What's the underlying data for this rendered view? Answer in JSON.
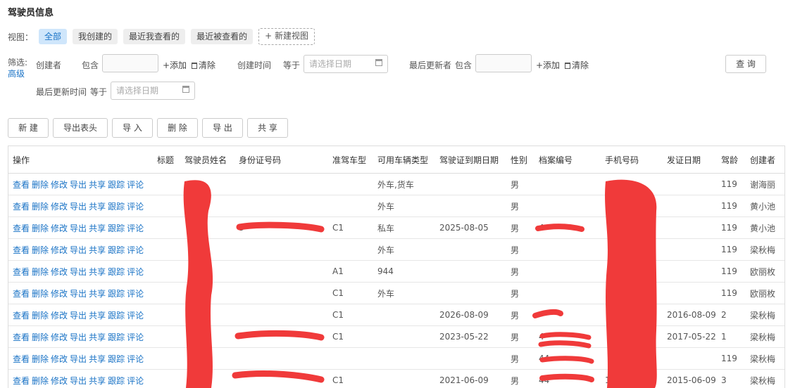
{
  "page_title": "驾驶员信息",
  "view": {
    "label": "视图：",
    "tabs": [
      "全部",
      "我创建的",
      "最近我查看的",
      "最近被查看的"
    ],
    "new_view": "+ 新建视图"
  },
  "filter": {
    "label": "筛选:",
    "advanced": "高级",
    "creator": "创建者",
    "contains": "包含",
    "add": "+添加",
    "clear": "清除",
    "create_time": "创建时间",
    "equals": "等于",
    "date_placeholder": "请选择日期",
    "last_updater": "最后更新者",
    "last_update_time": "最后更新时间",
    "query_button": "查 询"
  },
  "toolbar": [
    "新 建",
    "导出表头",
    "导 入",
    "删 除",
    "导 出",
    "共 享"
  ],
  "table": {
    "columns": [
      "操作",
      "标题",
      "驾驶员姓名",
      "身份证号码",
      "准驾车型",
      "可用车辆类型",
      "驾驶证到期日期",
      "性别",
      "档案编号",
      "手机号码",
      "发证日期",
      "驾龄",
      "创建者"
    ],
    "op_links": [
      "查看",
      "删除",
      "修改",
      "导出",
      "共享",
      "跟踪",
      "评论"
    ],
    "rows": [
      [
        "",
        "",
        "",
        "",
        "外车,货车",
        "",
        "男",
        "",
        "",
        "",
        "119",
        "谢海丽"
      ],
      [
        "",
        "",
        "",
        "",
        "外车",
        "",
        "男",
        "",
        "",
        "",
        "119",
        "黄小池"
      ],
      [
        "",
        "",
        "3",
        "C1",
        "私车",
        "2025-08-05",
        "男",
        "4",
        "",
        "",
        "119",
        "黄小池"
      ],
      [
        "",
        "",
        "",
        "",
        "外车",
        "",
        "男",
        "",
        "",
        "",
        "119",
        "梁秋梅"
      ],
      [
        "",
        "",
        "",
        "A1",
        "944",
        "",
        "男",
        "",
        "",
        "",
        "119",
        "欧丽枚"
      ],
      [
        "",
        "",
        "",
        "C1",
        "外车",
        "",
        "男",
        "",
        "",
        "",
        "119",
        "欧丽枚"
      ],
      [
        "",
        "",
        "",
        "C1",
        "",
        "2026-08-09",
        "男",
        "",
        "",
        "2016-08-09",
        "2",
        "梁秋梅"
      ],
      [
        "",
        "",
        "",
        "C1",
        "",
        "2023-05-22",
        "男",
        "4",
        "",
        "2017-05-22",
        "1",
        "梁秋梅"
      ],
      [
        "",
        "",
        "",
        "",
        "",
        "",
        "男",
        "44",
        "",
        "",
        "119",
        "梁秋梅"
      ],
      [
        "",
        "",
        "",
        "C1",
        "",
        "2021-06-09",
        "男",
        "44",
        "1",
        "2015-06-09",
        "3",
        "梁秋梅"
      ]
    ]
  },
  "colors": {
    "accent": "#1a73c6",
    "redaction": "#f03a3a"
  }
}
